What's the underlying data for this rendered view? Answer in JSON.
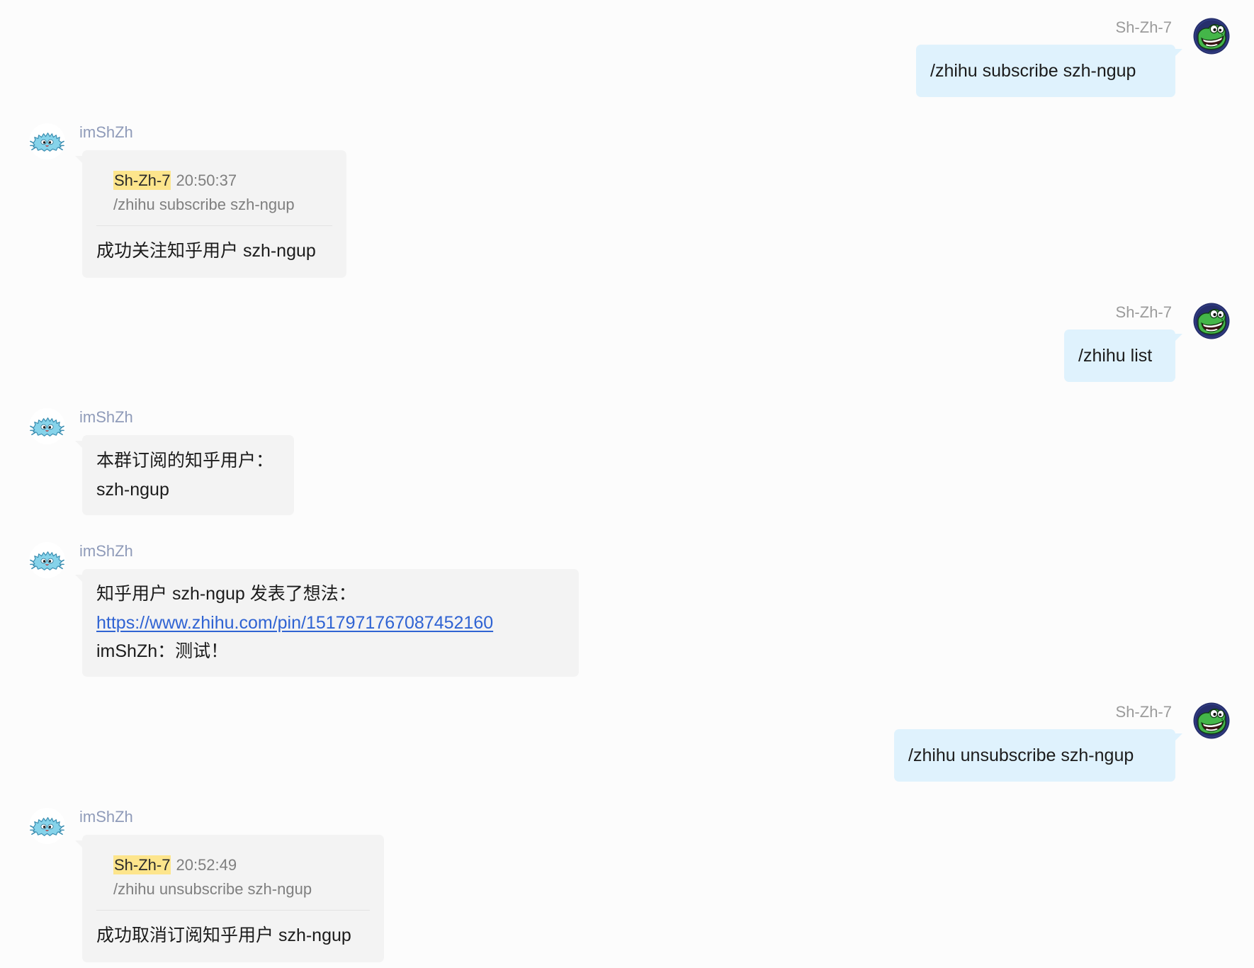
{
  "colors": {
    "background": "#fcfcfc",
    "bubble_self": "#dff2fd",
    "bubble_other": "#f3f3f3",
    "name_self": "#9b9b9b",
    "name_other": "#8f9bb9",
    "quote_highlight": "#fde58c",
    "quote_text": "#7f7f7f",
    "link": "#2f63d3"
  },
  "messages": [
    {
      "sender": "Sh-Zh-7",
      "avatar": "frog-avatar-icon",
      "text": "/zhihu subscribe szh-ngup"
    },
    {
      "sender": "imShZh",
      "avatar": "blue-crab-avatar-icon",
      "quote": {
        "sender": "Sh-Zh-7",
        "time": "20:50:37",
        "text": "/zhihu subscribe szh-ngup"
      },
      "text": "成功关注知乎用户 szh-ngup"
    },
    {
      "sender": "Sh-Zh-7",
      "avatar": "frog-avatar-icon",
      "text": "/zhihu list"
    },
    {
      "sender": "imShZh",
      "avatar": "blue-crab-avatar-icon",
      "lines": [
        "本群订阅的知乎用户：",
        "szh-ngup"
      ]
    },
    {
      "sender": "imShZh",
      "avatar": "blue-crab-avatar-icon",
      "lines": [
        "知乎用户 szh-ngup 发表了想法：",
        "https://www.zhihu.com/pin/1517971767087452160",
        "imShZh：测试！"
      ]
    },
    {
      "sender": "Sh-Zh-7",
      "avatar": "frog-avatar-icon",
      "text": "/zhihu unsubscribe szh-ngup"
    },
    {
      "sender": "imShZh",
      "avatar": "blue-crab-avatar-icon",
      "quote": {
        "sender": "Sh-Zh-7",
        "time": "20:52:49",
        "text": "/zhihu unsubscribe szh-ngup"
      },
      "text": "成功取消订阅知乎用户 szh-ngup"
    }
  ]
}
